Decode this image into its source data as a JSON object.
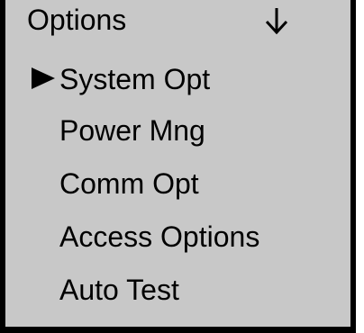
{
  "header": {
    "title": "Options",
    "scroll_indicator_icon": "down-arrow-icon"
  },
  "menu": {
    "selected_index": 0,
    "selector_icon": "right-triangle-icon",
    "items": [
      {
        "label": "System Opt"
      },
      {
        "label": "Power Mng"
      },
      {
        "label": "Comm Opt"
      },
      {
        "label": "Access Options"
      },
      {
        "label": "Auto Test"
      }
    ]
  }
}
